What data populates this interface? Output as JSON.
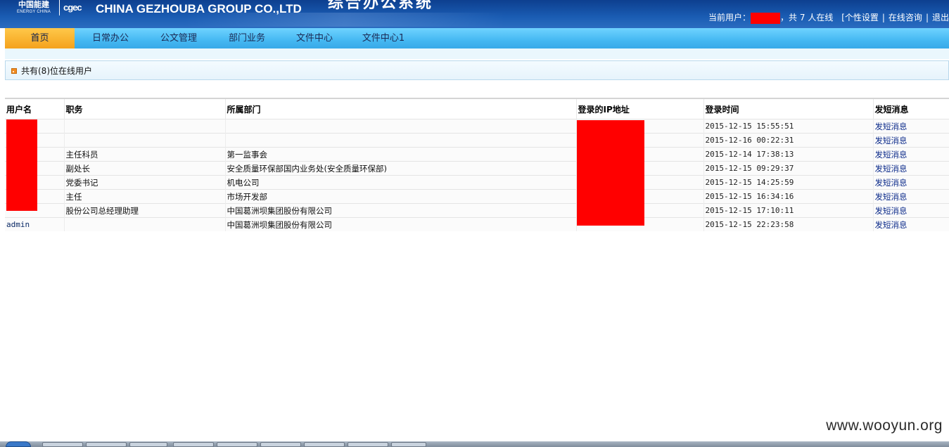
{
  "header": {
    "logo_cn": "中国能建",
    "logo_en": "ENERGY CHINA",
    "logo_mark": "cgec",
    "company_en": "CHINA GEZHOUBA GROUP CO.,LTD",
    "system_title": "综合办公系统",
    "current_user_label": "当前用户：",
    "online_prefix": "，共",
    "online_count": "7",
    "online_suffix": "人在线",
    "personal_settings": "[个性设置",
    "online_consult": "在线咨询",
    "logout": "退出",
    "separator": "|"
  },
  "nav": {
    "items": [
      {
        "label": "首页",
        "active": true
      },
      {
        "label": "日常办公"
      },
      {
        "label": "公文管理"
      },
      {
        "label": "部门业务"
      },
      {
        "label": "文件中心"
      },
      {
        "label": "文件中心1"
      }
    ]
  },
  "status": {
    "icon": "rss-icon",
    "text": "共有(8)位在线用户"
  },
  "table": {
    "headers": [
      "用户名",
      "职务",
      "所属部门",
      "登录的IP地址",
      "登录时间",
      "发短消息"
    ],
    "rows": [
      {
        "user": "",
        "position": "",
        "dept": "",
        "ip": "",
        "time": "2015-12-15 15:55:51",
        "action": "发短消息"
      },
      {
        "user": "",
        "position": "",
        "dept": "",
        "ip": "",
        "time": "2015-12-16 00:22:31",
        "action": "发短消息"
      },
      {
        "user": "",
        "position": "主任科员",
        "dept": "第一监事会",
        "ip": "",
        "time": "2015-12-14 17:38:13",
        "action": "发短消息"
      },
      {
        "user": "",
        "position": "副处长",
        "dept": "安全质量环保部国内业务处(安全质量环保部)",
        "ip": "",
        "time": "2015-12-15 09:29:37",
        "action": "发短消息"
      },
      {
        "user": "",
        "position": "党委书记",
        "dept": "机电公司",
        "ip": "",
        "time": "2015-12-15 14:25:59",
        "action": "发短消息"
      },
      {
        "user": "",
        "position": "主任",
        "dept": "市场开发部",
        "ip": "",
        "time": "2015-12-15 16:34:16",
        "action": "发短消息"
      },
      {
        "user": "",
        "position": "股份公司总经理助理",
        "dept": "中国葛洲坝集团股份有限公司",
        "ip": "",
        "time": "2015-12-15 17:10:11",
        "action": "发短消息"
      },
      {
        "user": "admin",
        "position": "",
        "dept": "中国葛洲坝集团股份有限公司",
        "ip": "",
        "time": "2015-12-15 22:23:58",
        "action": "发短消息"
      }
    ]
  },
  "watermark": "www.wooyun.org",
  "colors": {
    "banner": "#1a5cb3",
    "nav": "#45b8f2",
    "nav_active": "#f4a21c",
    "redaction": "#ff0000",
    "link": "#0b2a8a"
  }
}
